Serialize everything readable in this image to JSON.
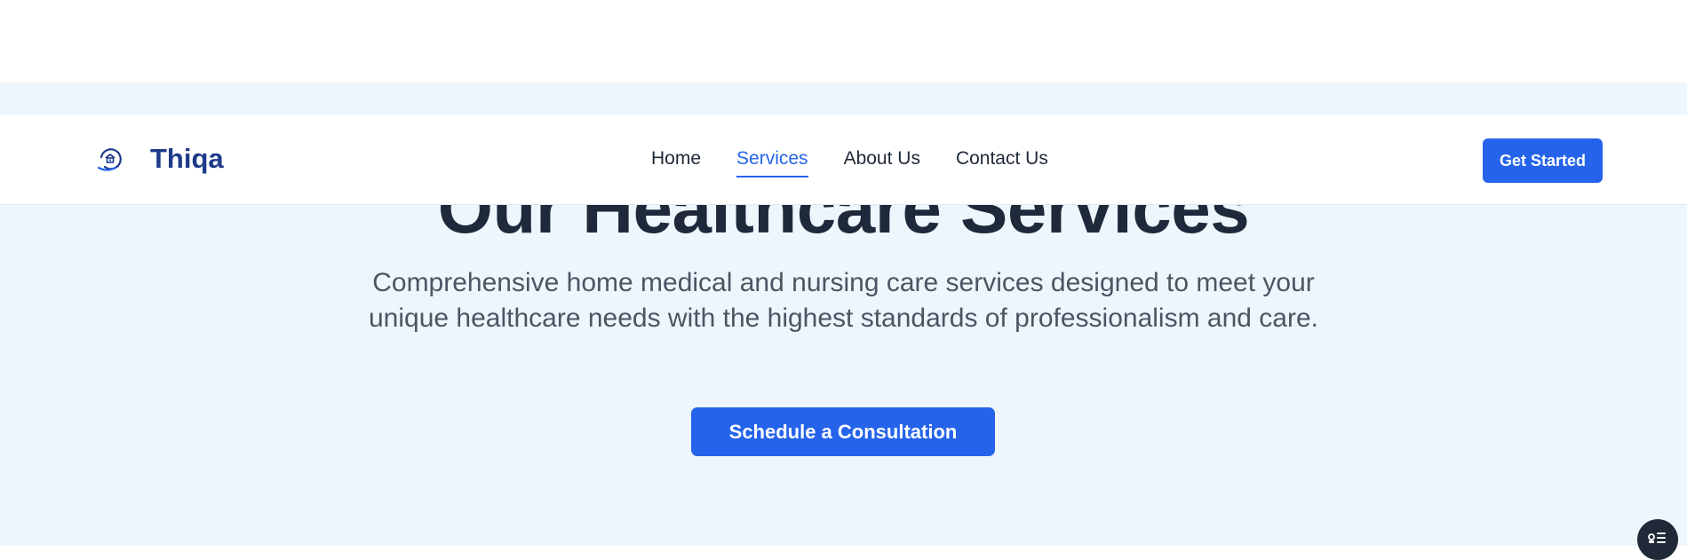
{
  "header": {
    "brand_name": "Thiqa",
    "logo_icon": "home-heart-logo-icon",
    "nav": [
      {
        "label": "Home",
        "active": false
      },
      {
        "label": "Services",
        "active": true
      },
      {
        "label": "About Us",
        "active": false
      },
      {
        "label": "Contact Us",
        "active": false
      }
    ],
    "cta_label": "Get Started"
  },
  "hero": {
    "title": "Our Healthcare Services",
    "subtitle": "Comprehensive home medical and nursing care services designed to meet your unique healthcare needs with the highest standards of professionalism and care.",
    "cta_label": "Schedule a Consultation"
  },
  "floating_widget": {
    "icon": "list-settings-icon"
  },
  "colors": {
    "primary": "#2563eb",
    "brand_text": "#1e3a8a",
    "hero_bg": "#eef6fd",
    "heading": "#1e293b",
    "body_text": "#4b5563"
  }
}
